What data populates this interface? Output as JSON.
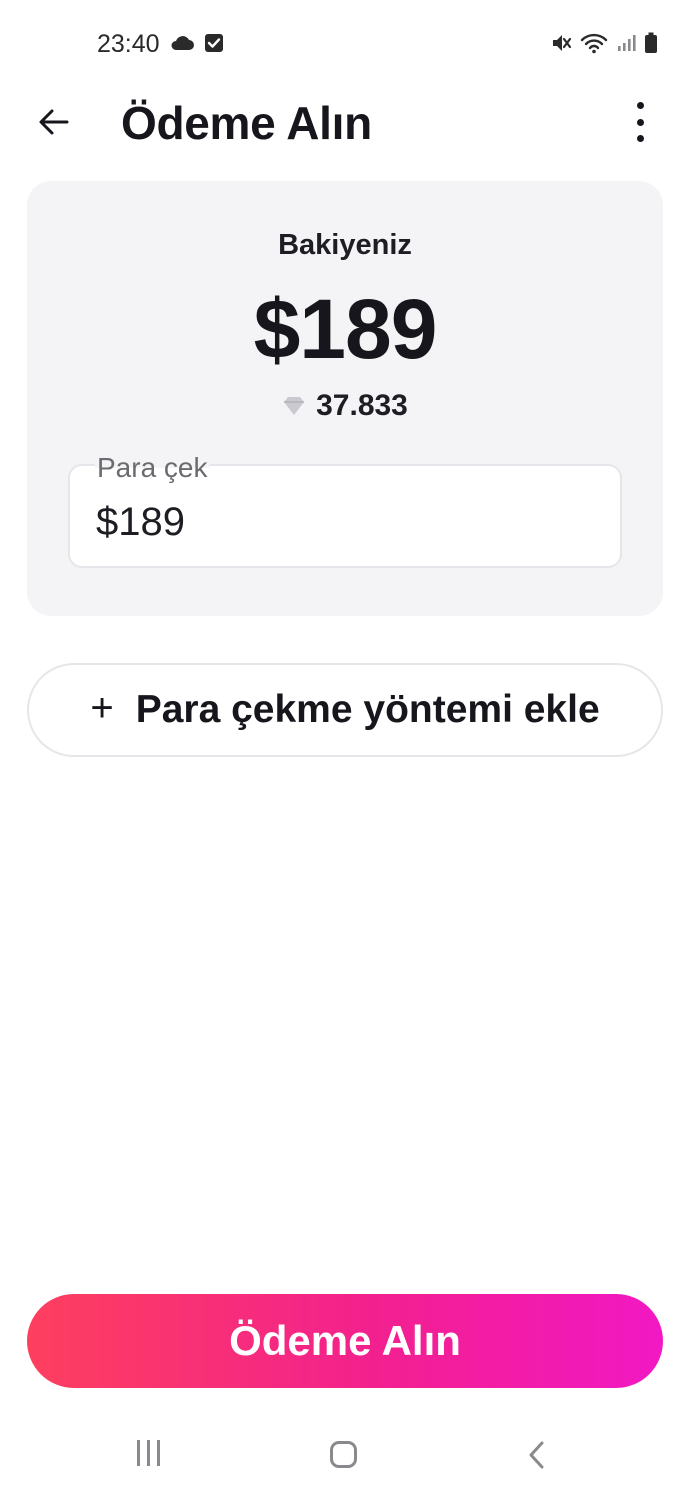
{
  "status_bar": {
    "time": "23:40",
    "left_icons": [
      "cloud-icon",
      "checkbox-icon"
    ],
    "right_icons": [
      "mute-icon",
      "wifi-icon",
      "signal-icon",
      "battery-icon"
    ]
  },
  "header": {
    "title": "Ödeme Alın",
    "back_icon": "arrow-left-icon",
    "more_icon": "more-vertical-icon"
  },
  "balance": {
    "label": "Bakiyeniz",
    "amount": "$189",
    "diamond_icon": "diamond-icon",
    "diamond_count": "37.833"
  },
  "withdraw": {
    "label": "Para çek",
    "value": "$189"
  },
  "add_method": {
    "icon": "plus-icon",
    "plus": "+",
    "label": "Para çekme yöntemi ekle"
  },
  "primary_button": {
    "label": "Ödeme Alın"
  },
  "nav_bar": {
    "items": [
      "recents-icon",
      "home-icon",
      "back-icon"
    ]
  },
  "colors": {
    "card_bg": "#f4f4f6",
    "gradient_start": "#fe3f5e",
    "gradient_end": "#f218c4",
    "text_primary": "#16161c"
  }
}
